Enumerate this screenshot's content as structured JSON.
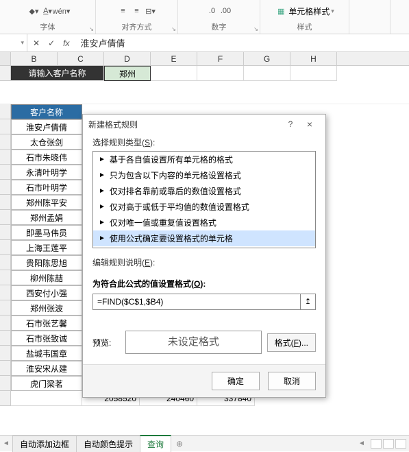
{
  "ribbon": {
    "groups": {
      "font": "字体",
      "align": "对齐方式",
      "number": "数字",
      "styles": "样式",
      "cell_styles_btn": "单元格样式"
    }
  },
  "formula_bar": {
    "fx": "fx",
    "value": "淮安卢倩倩"
  },
  "columns": [
    "B",
    "C",
    "D",
    "E",
    "F",
    "G",
    "H"
  ],
  "row1": {
    "prompt": "请输入客户名称",
    "input": "郑州"
  },
  "data_header": "客户名称",
  "customers": [
    "淮安卢倩倩",
    "太仓张剑",
    "石市朱晓伟",
    "永清叶明学",
    "石市叶明学",
    "郑州陈平安",
    "郑州孟娟",
    "即墨马伟员",
    "上海王莲平",
    "贵阳陈思旭",
    "柳州陈喆",
    "西安付小强",
    "郑州张波",
    "石市张艺馨",
    "石市张致诚",
    "盐城韦国章",
    "淮安宋从建",
    "虎门梁茗"
  ],
  "bottom_nums": [
    "2058520",
    "240460",
    "337840"
  ],
  "dialog": {
    "title": "新建格式规则",
    "help": "?",
    "close": "×",
    "select_type_label": "选择规则类型(S):",
    "rules": [
      "基于各自值设置所有单元格的格式",
      "只为包含以下内容的单元格设置格式",
      "仅对排名靠前或靠后的数值设置格式",
      "仅对高于或低于平均值的数值设置格式",
      "仅对唯一值或重复值设置格式",
      "使用公式确定要设置格式的单元格"
    ],
    "edit_desc_label": "编辑规则说明(E):",
    "formula_label": "为符合此公式的值设置格式(O):",
    "formula_value": "=FIND($C$1,$B4)",
    "ref_icon": "↥",
    "preview_label": "预览:",
    "preview_text": "未设定格式",
    "format_btn": "格式(F)...",
    "ok": "确定",
    "cancel": "取消"
  },
  "tabs": {
    "t1": "自动添加边框",
    "t2": "自动颜色提示",
    "t3": "查询",
    "add": "⊕"
  }
}
